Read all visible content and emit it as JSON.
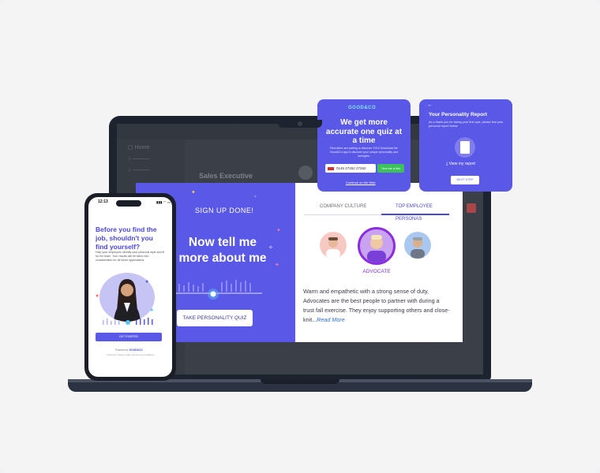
{
  "laptop_app": {
    "signup_done": "SIGN UP DONE!",
    "headline": "Now tell me more about me",
    "take_quiz_button": "TAKE PERSONALITY QUIZ",
    "tabs": [
      "COMPANY CULTURE",
      "TOP EMPLOYEE PERSONAS"
    ],
    "active_tab": "TOP EMPLOYEE PERSONAS",
    "selected_persona": "ADVOCATE",
    "description": "Warm and empathetic with a strong sense of duty, Advocates are the best people to partner with during a trust fall exercise. They enjoy supporting others and close-knit...",
    "read_more": "Read More",
    "accent_color": "#5a58e6",
    "background_job_title": "Sales Executive"
  },
  "phone_app": {
    "time": "12:13",
    "status": "▮▮▮ ◠ ▭",
    "headline": "Before you find the job, shouldn't you find yourself?",
    "body": "Help your employers identify your personal style and fit for the team. Your results will be taken into consideration for all future applications.",
    "get_started_button": "GET STARTED",
    "powered_by_prefix": "Powered by",
    "powered_by_brand": "GOOD&CO",
    "legal": "Consent to privacy policy and terms & conditions"
  },
  "quiz_card": {
    "logo": "GOOD&CO",
    "headline": "We get more accurate one quiz at a time",
    "subtext": "Recruiters are waiting to discover YOU! Download the Good&Co app to discover your unique personality and strengths.",
    "phone_value": "0145 27262 27262",
    "send_link_button": "Text me a link",
    "continue_link": "Continue on the Web"
  },
  "report_card": {
    "back_label": "←",
    "title": "Your Personality Report",
    "subtext": "As a thank you for taking your first quiz, please find your personal report below.",
    "view_report": "View my report",
    "next_step_button": "NEXT STEP"
  }
}
